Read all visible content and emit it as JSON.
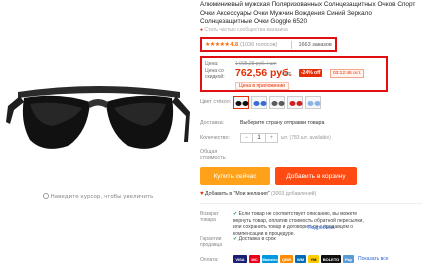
{
  "product": {
    "title": "Алюминиевый мужская Поляризованных Солнцезащитных Очков Спорт Очки Аксессуары Очки Мужчин Вождения Синий Зеркало Солнцезащитные Очки Goggle 6520",
    "zoom_hint": "Наведите курсор, чтобы увеличить",
    "subnote": "Стать частью сообщества магазина",
    "stars": "★★★★★",
    "rating": "4.8",
    "votes": "(1036 голосов)",
    "orders": "1663 заказов"
  },
  "price": {
    "price_label": "Цена:",
    "old_price": "1 005,28 руб. / шт.",
    "discount_label": "Цена со скидкой:",
    "new_price": "762,56 руб.",
    "per_unit": "/ шт.",
    "discount": "-24% off",
    "coupon": "03:12:46 ост.",
    "mobile_price": "Цена в приложении"
  },
  "options": {
    "color_label": "Цвет стёкол:",
    "shipping_label": "Доставка:",
    "shipping_text": "Выберите страну отправки товара",
    "qty_label": "Количество:",
    "qty_minus": "−",
    "qty_value": "1",
    "qty_plus": "+",
    "avail": "шт. (783 шт. available)",
    "total_label_1": "Общая",
    "total_label_2": "стоимость:"
  },
  "actions": {
    "buy_now": "Купить сейчас",
    "add_to_cart": "Добавить в корзину",
    "wishlist": "Добавить в \"Мои желания\"",
    "wishlist_count": "(3003 добавлений)"
  },
  "protection": {
    "label_1": "Возврат",
    "label_2": "товара",
    "text": "Если товар не соответствует описанию, вы можете вернуть товар, оплатив стоимость обратной пересылки, или сохранить товар и договориться с продавцом о компенсации в процедуре.",
    "more": "Подробнее",
    "guarantee_label_1": "Гарантии",
    "guarantee_label_2": "продавца",
    "guarantee_text": "Доставка в срок"
  },
  "payment": {
    "label": "Оплата:",
    "methods": [
      "VISA",
      "MC",
      "Maestro",
      "QIWI",
      "WM",
      "YM",
      "BOLETO",
      "Pay"
    ],
    "more": "Показать все"
  },
  "colors": {
    "accent": "#e62e04",
    "buy_now": "#ffa21a",
    "add_to_cart": "#ff4b12",
    "highlight": "#e10f0f"
  }
}
